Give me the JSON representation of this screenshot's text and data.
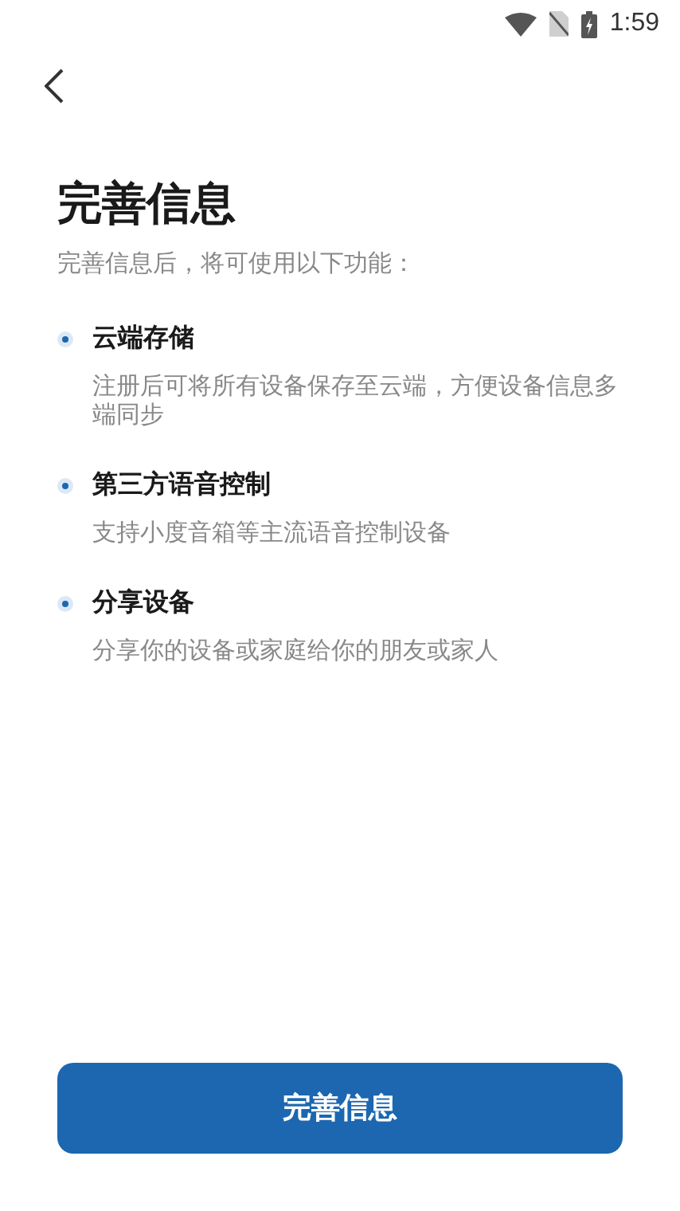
{
  "status_bar": {
    "time": "1:59"
  },
  "title": "完善信息",
  "subtitle": "完善信息后，将可使用以下功能：",
  "features": [
    {
      "title": "云端存储",
      "description": "注册后可将所有设备保存至云端，方便设备信息多端同步"
    },
    {
      "title": "第三方语音控制",
      "description": "支持小度音箱等主流语音控制设备"
    },
    {
      "title": "分享设备",
      "description": "分享你的设备或家庭给你的朋友或家人"
    }
  ],
  "button": {
    "label": "完善信息"
  }
}
